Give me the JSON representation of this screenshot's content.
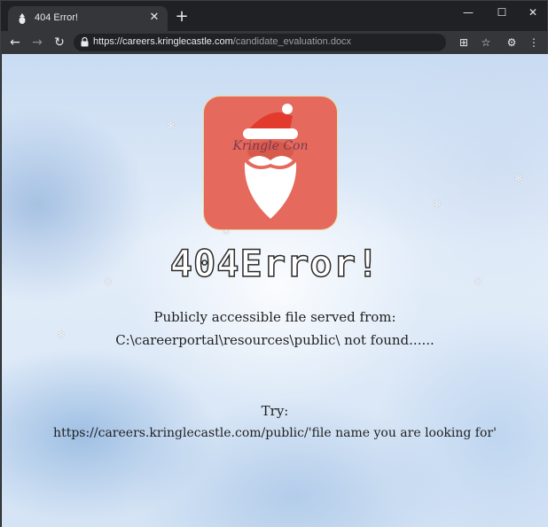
{
  "tab": {
    "title": "404 Error!"
  },
  "window_controls": {
    "minimize": "—",
    "maximize": "☐",
    "close": "✕"
  },
  "address_bar": {
    "url_host": "https://careers.kringlecastle.com",
    "url_path": "/candidate_evaluation.docx"
  },
  "logo": {
    "text": "Kringle Con"
  },
  "page": {
    "heading": "404Error!",
    "line1": "Publicly accessible file served from:",
    "line2": "C:\\careerportal\\resources\\public\\ not found......",
    "try_label": "Try:",
    "try_url": "https://careers.kringlecastle.com/public/'file name you are looking for'"
  },
  "colors": {
    "logo_bg": "#e5695c",
    "chrome_bg": "#202124",
    "toolbar_bg": "#35363a"
  },
  "icons": [
    "favicon-santa-icon",
    "close-icon",
    "plus-icon",
    "back-icon",
    "forward-icon",
    "reload-icon",
    "lock-icon",
    "translate-icon",
    "star-icon",
    "extension-icon",
    "menu-icon",
    "snowflake-icon"
  ]
}
